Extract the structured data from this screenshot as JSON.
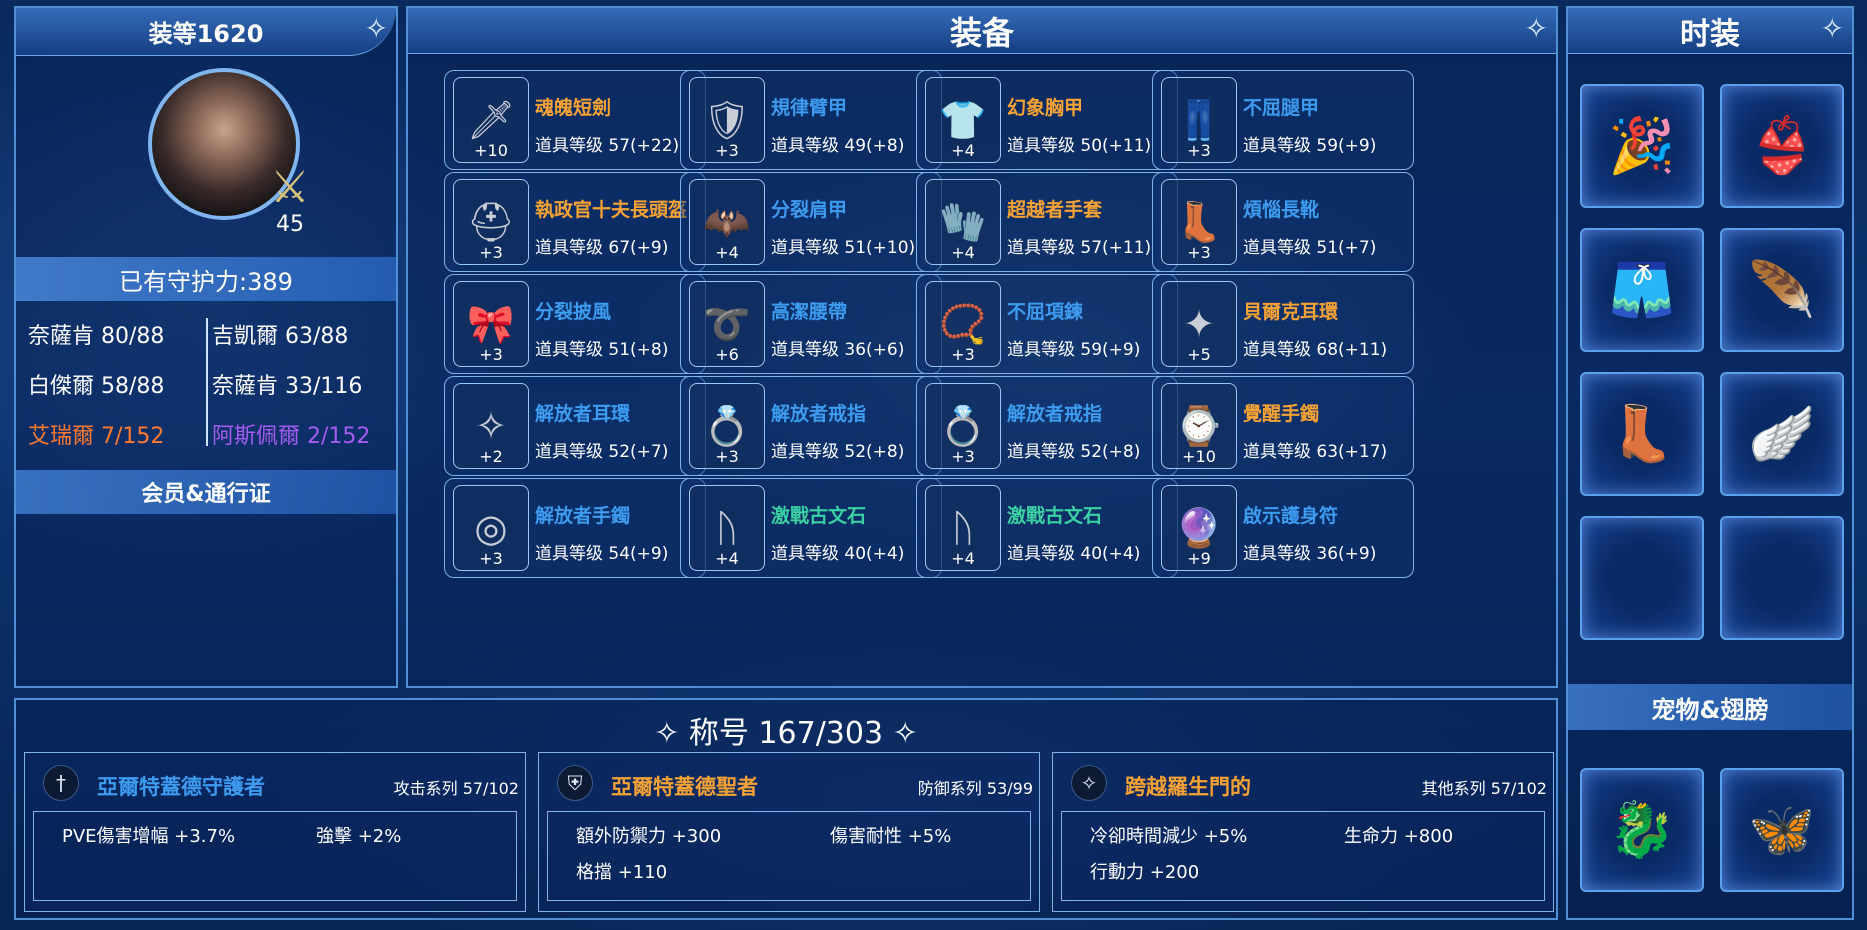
{
  "colors": {
    "orange": "#f7a234",
    "blue": "#3d9bf0",
    "teal": "#3bd1a3",
    "purple": "#a45cf0",
    "orange_stat": "#ff7a2e"
  },
  "left": {
    "gear_score": "装等1620",
    "level": "45",
    "guard_label": "已有守护力:389",
    "stats": [
      {
        "text": "奈薩肯 80/88",
        "color": "#ffffff"
      },
      {
        "text": "吉凱爾 63/88",
        "color": "#ffffff"
      },
      {
        "text": "白傑爾 58/88",
        "color": "#ffffff"
      },
      {
        "text": "奈薩肯 33/116",
        "color": "#ffffff"
      },
      {
        "text": "艾瑞爾 7/152",
        "color": "#ff7a2e"
      },
      {
        "text": "阿斯佩爾 2/152",
        "color": "#a45cf0"
      }
    ],
    "member_label": "会员&通行证"
  },
  "equip": {
    "title": "装备",
    "items": [
      {
        "name": "魂魄短劍",
        "level": "道具等级 57(+22)",
        "plus": "+10",
        "color": "#f7a234",
        "icon": "dagger-icon",
        "glyph": "🗡"
      },
      {
        "name": "規律臂甲",
        "level": "道具等级 49(+8)",
        "plus": "+3",
        "color": "#3d9bf0",
        "icon": "arm-guard-icon",
        "glyph": "🛡"
      },
      {
        "name": "幻象胸甲",
        "level": "道具等级 50(+11)",
        "plus": "+4",
        "color": "#f7a234",
        "icon": "chest-armor-icon",
        "glyph": "👕"
      },
      {
        "name": "不屈腿甲",
        "level": "道具等级 59(+9)",
        "plus": "+3",
        "color": "#3d9bf0",
        "icon": "leg-armor-icon",
        "glyph": "👖"
      },
      {
        "name": "執政官十夫長頭盔",
        "level": "道具等级 67(+9)",
        "plus": "+3",
        "color": "#f7a234",
        "icon": "helmet-icon",
        "glyph": "⛑"
      },
      {
        "name": "分裂肩甲",
        "level": "道具等级 51(+10)",
        "plus": "+4",
        "color": "#3d9bf0",
        "icon": "shoulder-armor-icon",
        "glyph": "🦇"
      },
      {
        "name": "超越者手套",
        "level": "道具等级 57(+11)",
        "plus": "+4",
        "color": "#f7a234",
        "icon": "gloves-icon",
        "glyph": "🧤"
      },
      {
        "name": "煩惱長靴",
        "level": "道具等级 51(+7)",
        "plus": "+3",
        "color": "#3d9bf0",
        "icon": "boots-icon",
        "glyph": "👢"
      },
      {
        "name": "分裂披風",
        "level": "道具等级 51(+8)",
        "plus": "+3",
        "color": "#3d9bf0",
        "icon": "cape-icon",
        "glyph": "🎀"
      },
      {
        "name": "高潔腰帶",
        "level": "道具等级 36(+6)",
        "plus": "+6",
        "color": "#3d9bf0",
        "icon": "belt-icon",
        "glyph": "➰"
      },
      {
        "name": "不屈項鍊",
        "level": "道具等级 59(+9)",
        "plus": "+3",
        "color": "#3d9bf0",
        "icon": "necklace-icon",
        "glyph": "📿"
      },
      {
        "name": "貝爾克耳環",
        "level": "道具等级 68(+11)",
        "plus": "+5",
        "color": "#f7a234",
        "icon": "earring-icon",
        "glyph": "✦"
      },
      {
        "name": "解放者耳環",
        "level": "道具等级 52(+7)",
        "plus": "+2",
        "color": "#3d9bf0",
        "icon": "earring-icon",
        "glyph": "✧"
      },
      {
        "name": "解放者戒指",
        "level": "道具等级 52(+8)",
        "plus": "+3",
        "color": "#3d9bf0",
        "icon": "ring-icon",
        "glyph": "💍"
      },
      {
        "name": "解放者戒指",
        "level": "道具等级 52(+8)",
        "plus": "+3",
        "color": "#3d9bf0",
        "icon": "ring-icon",
        "glyph": "💍"
      },
      {
        "name": "覺醒手鐲",
        "level": "道具等级 63(+17)",
        "plus": "+10",
        "color": "#f7a234",
        "icon": "bracelet-icon",
        "glyph": "⌚"
      },
      {
        "name": "解放者手鐲",
        "level": "道具等级 54(+9)",
        "plus": "+3",
        "color": "#3d9bf0",
        "icon": "bracelet-icon",
        "glyph": "◎"
      },
      {
        "name": "激戰古文石",
        "level": "道具等级 40(+4)",
        "plus": "+4",
        "color": "#3bd1a3",
        "icon": "rune-stone-icon",
        "glyph": "ᚢ"
      },
      {
        "name": "激戰古文石",
        "level": "道具等级 40(+4)",
        "plus": "+4",
        "color": "#3bd1a3",
        "icon": "rune-stone-icon",
        "glyph": "ᚢ"
      },
      {
        "name": "啟示護身符",
        "level": "道具等级 36(+9)",
        "plus": "+9",
        "color": "#3d9bf0",
        "icon": "amulet-icon",
        "glyph": "🔮"
      }
    ]
  },
  "fashion": {
    "title": "时装",
    "slots": [
      {
        "icon": "party-hat-icon",
        "glyph": "🎉"
      },
      {
        "icon": "top-outfit-icon",
        "glyph": "👙"
      },
      {
        "icon": "shorts-icon",
        "glyph": "🩳"
      },
      {
        "icon": "cape-outfit-icon",
        "glyph": "🪶"
      },
      {
        "icon": "boots-outfit-icon",
        "glyph": "👢"
      },
      {
        "icon": "wing-icon",
        "glyph": "🪽"
      },
      {
        "icon": "empty-slot-icon",
        "glyph": ""
      },
      {
        "icon": "empty-slot-icon",
        "glyph": ""
      }
    ],
    "pet_title": "宠物&翅膀",
    "pets": [
      {
        "icon": "pet-icon",
        "glyph": "🐉"
      },
      {
        "icon": "wings-icon",
        "glyph": "🦋"
      }
    ]
  },
  "titles": {
    "header": "称号 167/303",
    "cards": [
      {
        "name": "亞爾特蓋德守護者",
        "color": "#3d9bf0",
        "series": "攻击系列 57/102",
        "icon": "sword-emblem-icon",
        "glyph": "†",
        "stats": [
          "PVE傷害增幅 +3.7%",
          "強擊 +2%",
          ""
        ]
      },
      {
        "name": "亞爾特蓋德聖者",
        "color": "#f7a234",
        "series": "防御系列 53/99",
        "icon": "shield-emblem-icon",
        "glyph": "⛨",
        "stats": [
          "額外防禦力 +300",
          "傷害耐性 +5%",
          "格擋 +110"
        ]
      },
      {
        "name": "跨越羅生門的",
        "color": "#f7a234",
        "series": "其他系列 57/102",
        "icon": "star-emblem-icon",
        "glyph": "✧",
        "stats": [
          "冷卻時間減少 +5%",
          "生命力 +800",
          "行動力 +200"
        ]
      }
    ]
  }
}
